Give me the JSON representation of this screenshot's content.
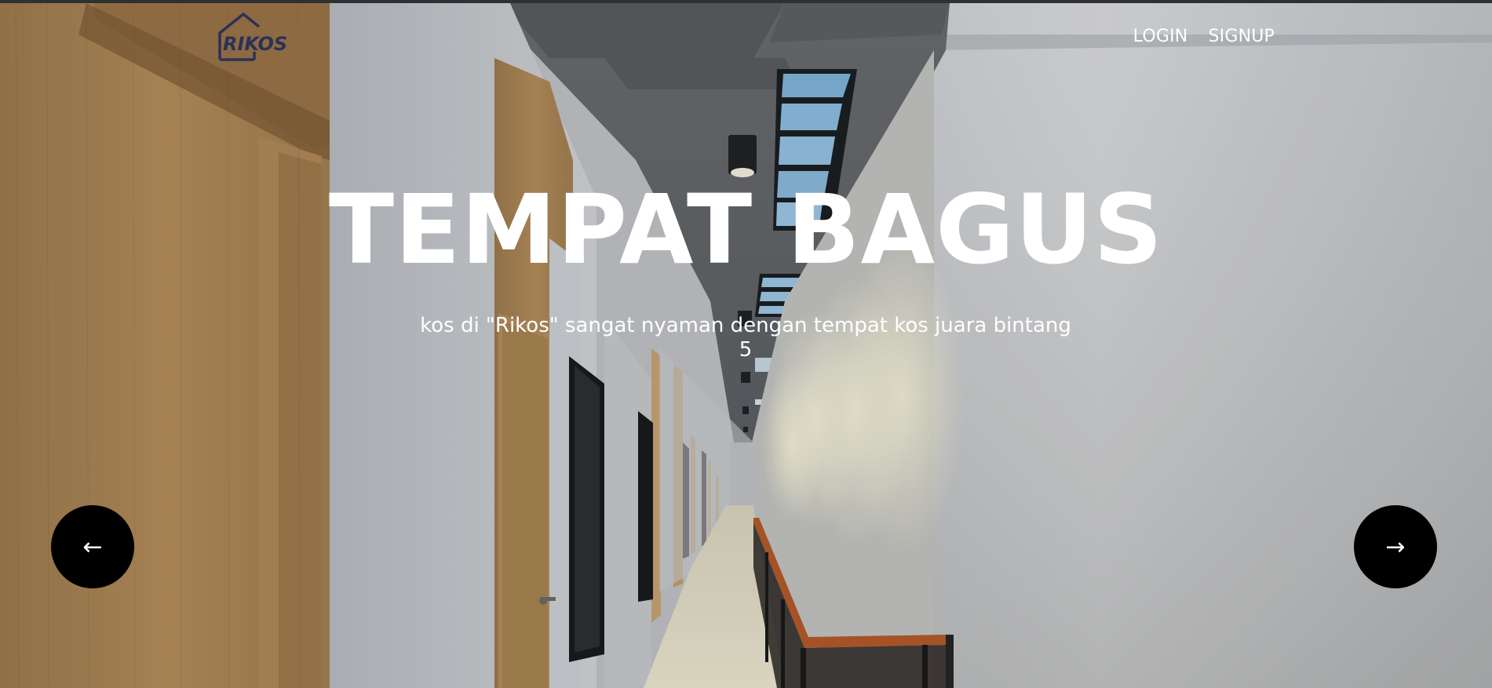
{
  "brand": {
    "logo_text": "RIKOS",
    "logo_color": "#2d3157"
  },
  "nav": {
    "login_label": "LOGIN",
    "signup_label": "SIGNUP"
  },
  "hero": {
    "headline": "TEMPAT BAGUS",
    "subtitle": "kos di \"Rikos\" sangat nyaman dengan tempat kos juara bintang 5"
  },
  "carousel": {
    "prev_icon": "←",
    "next_icon": "→"
  }
}
